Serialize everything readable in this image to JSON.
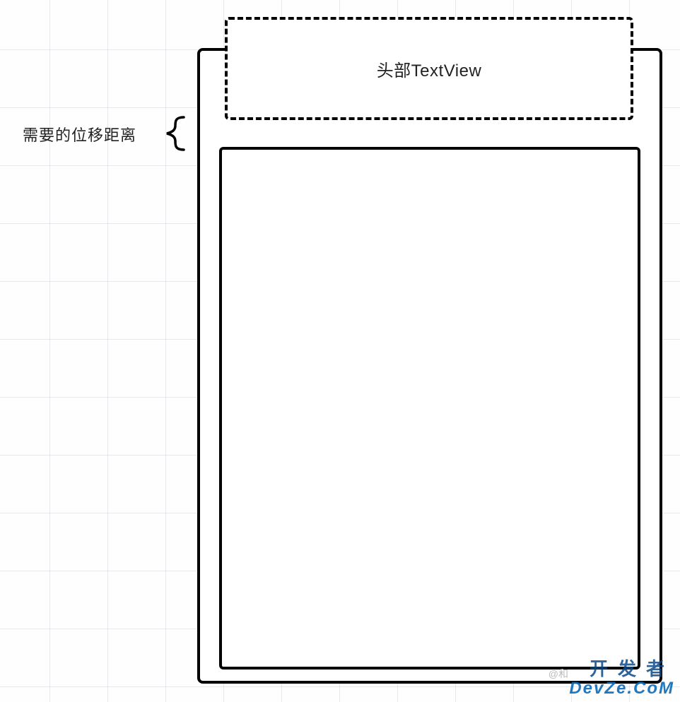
{
  "header": {
    "label": "头部TextView"
  },
  "annotation": {
    "offset_label": "需要的位移距离"
  },
  "watermark": {
    "cn": "开发者",
    "en": "DevZe.CoM",
    "small": "@和"
  }
}
